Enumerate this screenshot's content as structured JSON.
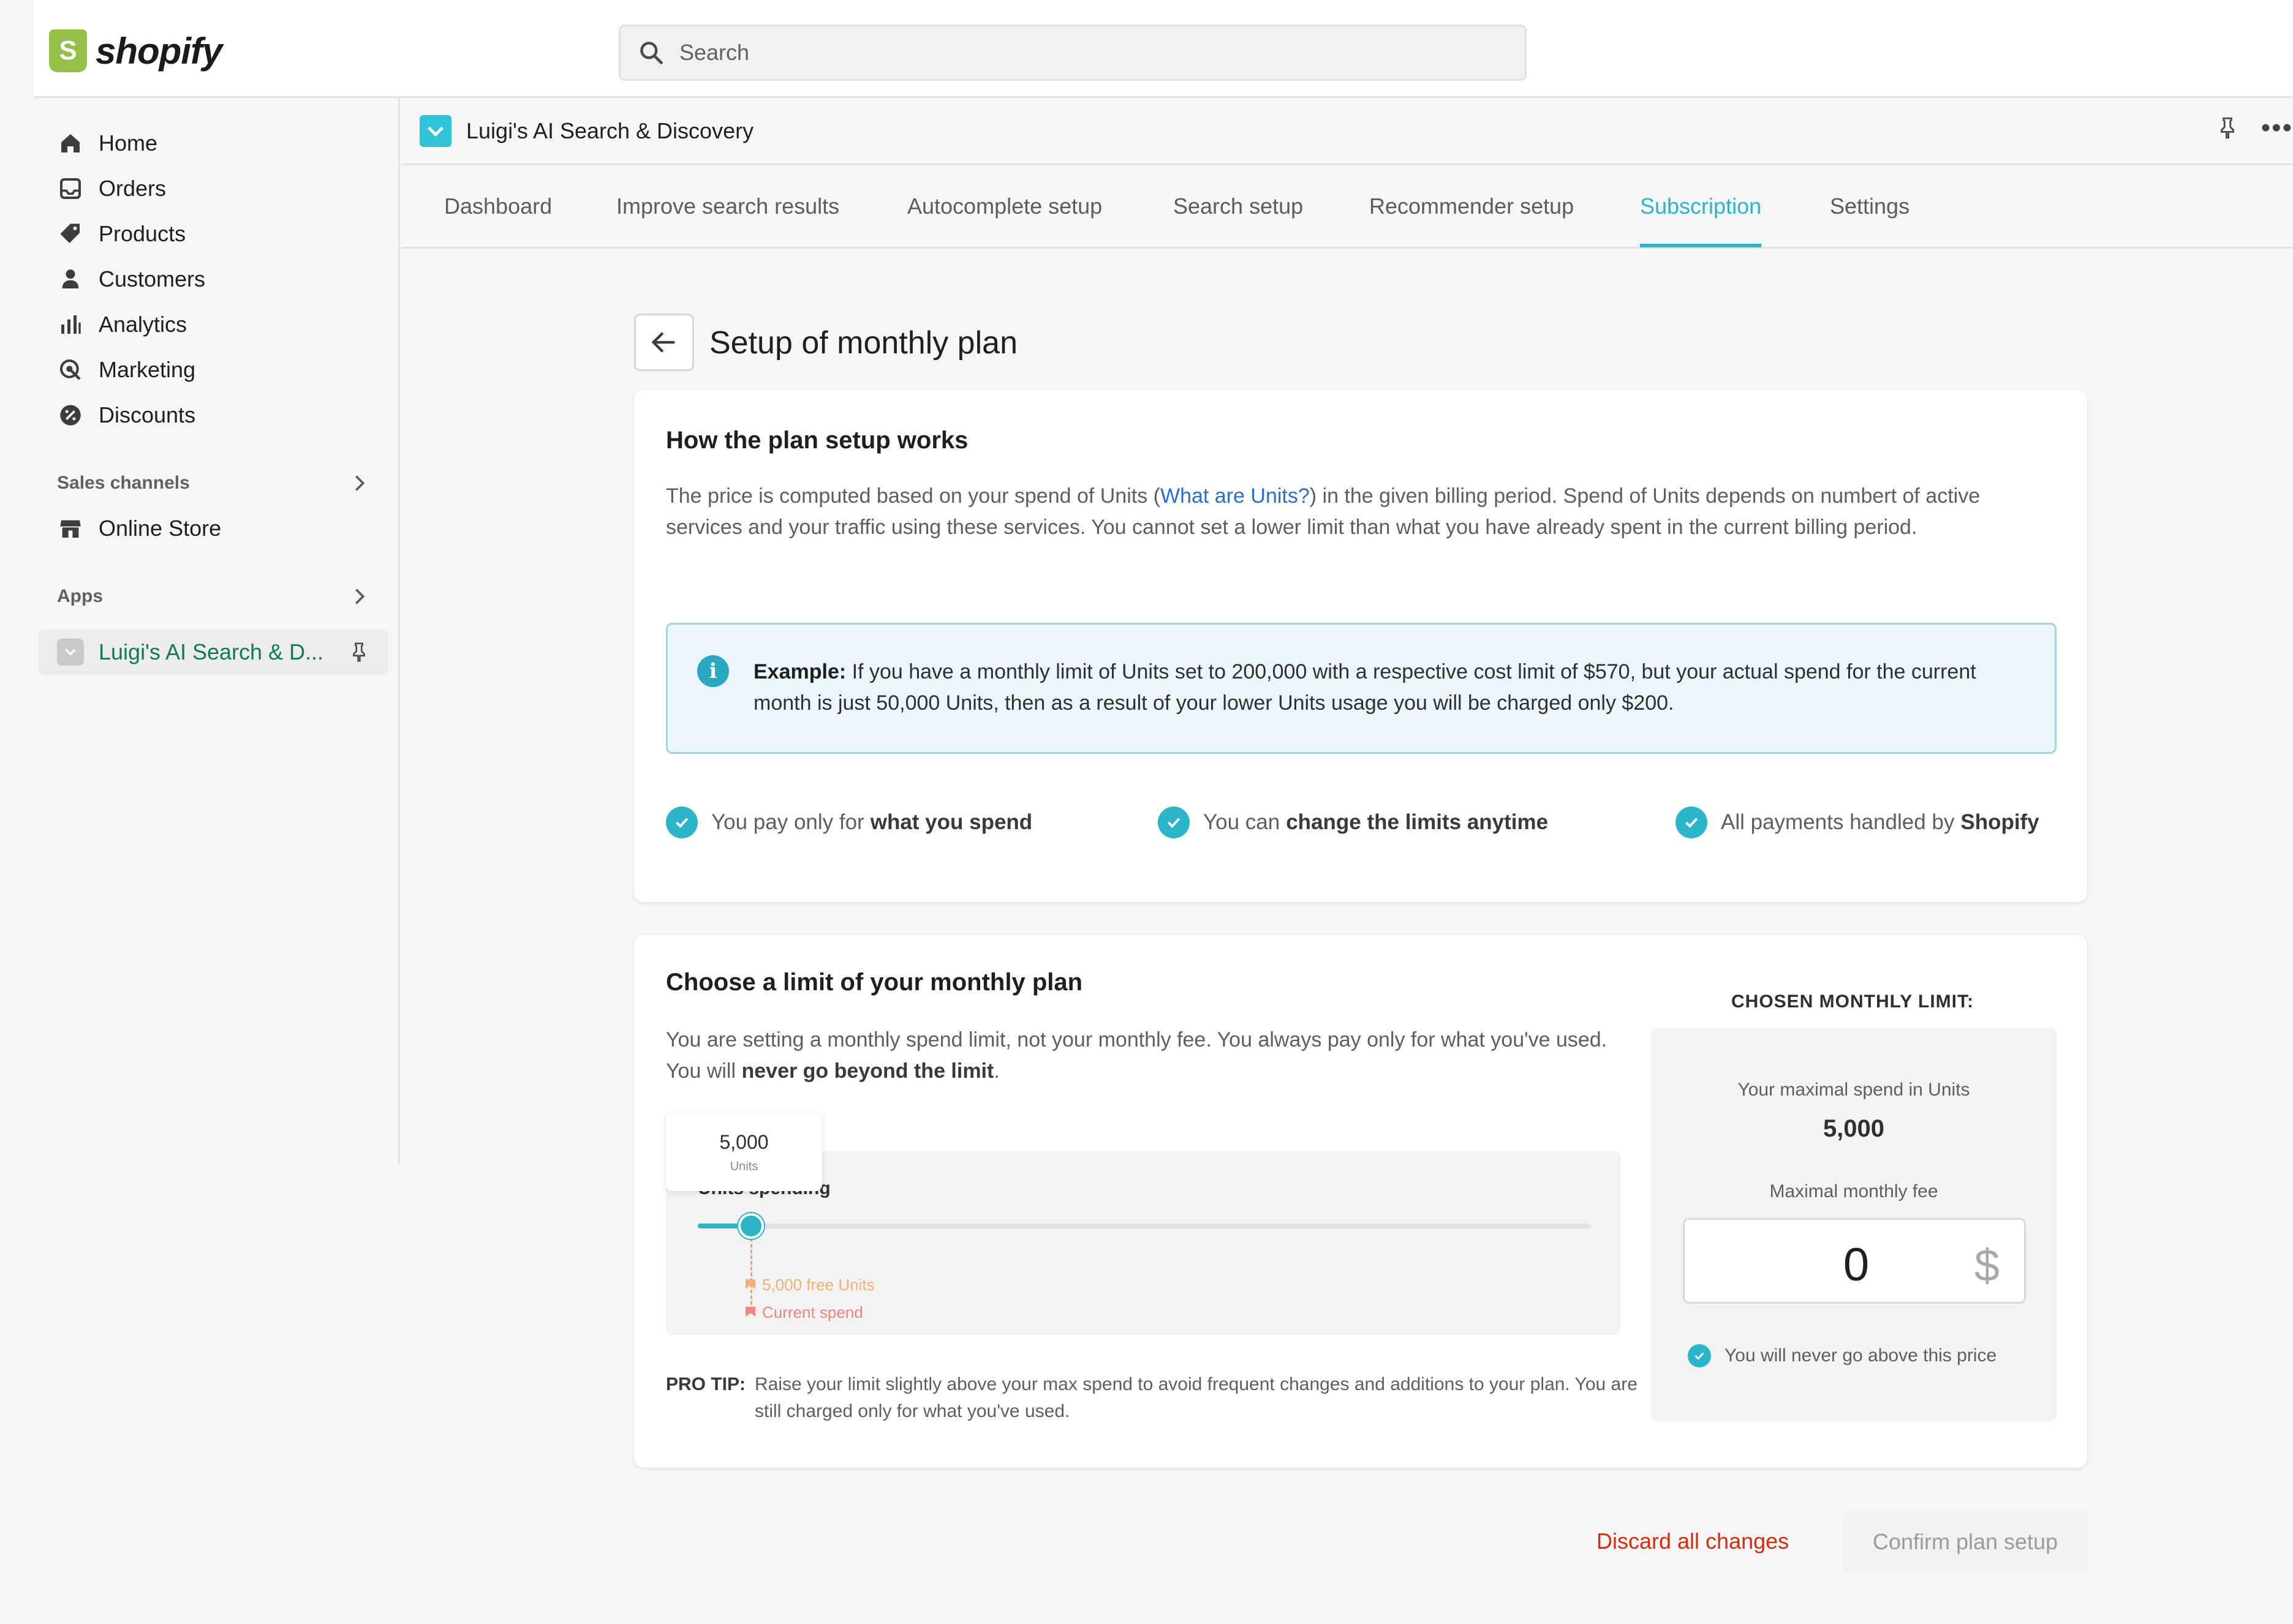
{
  "brand": {
    "name": "shopify",
    "logo_icon": "shopify-bag-icon",
    "color": "#95bf47"
  },
  "search": {
    "placeholder": "Search"
  },
  "sidebar": {
    "items": [
      {
        "label": "Home",
        "icon": "home-icon"
      },
      {
        "label": "Orders",
        "icon": "orders-icon"
      },
      {
        "label": "Products",
        "icon": "tag-icon"
      },
      {
        "label": "Customers",
        "icon": "person-icon"
      },
      {
        "label": "Analytics",
        "icon": "bar-chart-icon"
      },
      {
        "label": "Marketing",
        "icon": "target-icon"
      },
      {
        "label": "Discounts",
        "icon": "discount-icon"
      }
    ],
    "sales_channels_label": "Sales channels",
    "online_store_label": "Online Store",
    "apps_label": "Apps",
    "app_label": "Luigi's AI Search & D..."
  },
  "appbar": {
    "title": "Luigi's AI Search & Discovery",
    "accent": "#2ec4d6"
  },
  "tabs": [
    {
      "label": "Dashboard"
    },
    {
      "label": "Improve search results"
    },
    {
      "label": "Autocomplete setup"
    },
    {
      "label": "Search setup"
    },
    {
      "label": "Recommender setup"
    },
    {
      "label": "Subscription",
      "active": true
    },
    {
      "label": "Settings"
    }
  ],
  "page": {
    "title": "Setup of monthly plan"
  },
  "how": {
    "title": "How the plan setup works",
    "p_before": "The price is computed based on your spend of Units (",
    "p_link": "What are Units?",
    "p_after": ") in the given billing period. Spend of Units depends on numbert of active services and your traffic using these services. You cannot set a lower limit than what you have already spent in the current billing period.",
    "example_label": "Example:",
    "example_text": " If you have a monthly limit of Units set to 200,000 with a respective cost limit of $570, but your actual spend for the current month is just 50,000 Units, then as a result of your lower Units usage you will be charged only $200.",
    "features": [
      {
        "pre": "You pay only for",
        "bold": "what you spend"
      },
      {
        "pre": "You can",
        "bold": "change the limits anytime"
      },
      {
        "pre": "All payments handled by",
        "bold": "Shopify"
      }
    ]
  },
  "limit": {
    "title": "Choose a limit of your monthly plan",
    "desc_pre": "You are setting a monthly spend limit, not your monthly fee. You always pay only for what you've used. You will ",
    "desc_bold": "never go beyond the limit",
    "desc_post": ".",
    "slider_label": "Units spending",
    "slider_fraction": 0.06,
    "tooltip_value": "5,000",
    "tooltip_unit": "Units",
    "marker_free": "5,000 free Units",
    "marker_current": "Current spend",
    "protip_label": "PRO TIP:",
    "protip_text": "Raise your limit slightly above your max spend to avoid frequent changes and additions to your plan. You are still charged only for what you've used.",
    "chosen_title": "CHOSEN MONTHLY LIMIT:",
    "max_units_label": "Your maximal spend in Units",
    "max_units_value": "5,000",
    "fee_label": "Maximal monthly fee",
    "fee_value": "0",
    "fee_currency": "$",
    "never_text": "You will never go above this price"
  },
  "actions": {
    "discard": "Discard all changes",
    "confirm": "Confirm plan setup",
    "danger_color": "#d72c0d"
  }
}
